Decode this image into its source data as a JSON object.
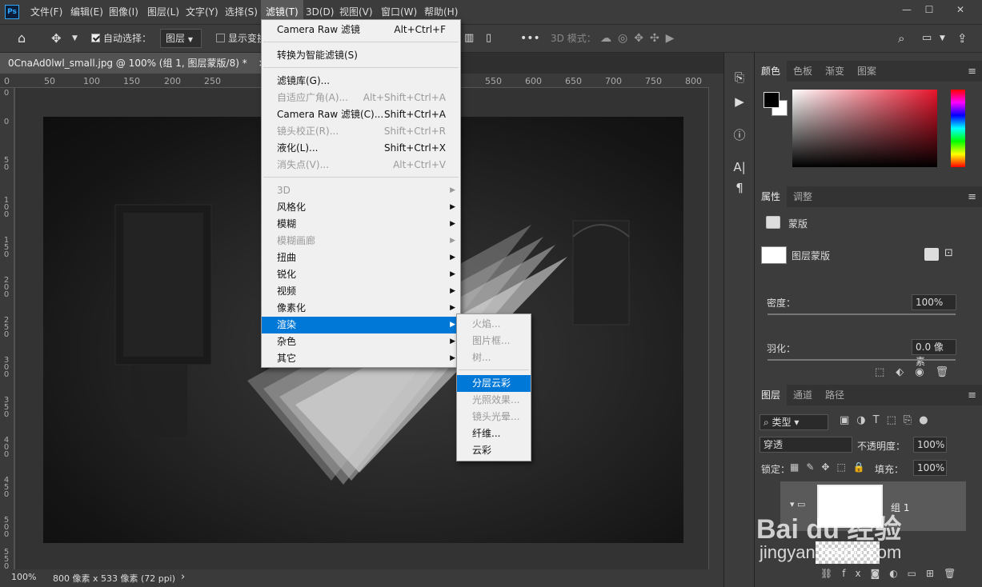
{
  "app": {
    "logo": "Ps"
  },
  "menubar": {
    "items": [
      "文件(F)",
      "编辑(E)",
      "图像(I)",
      "图层(L)",
      "文字(Y)",
      "选择(S)",
      "滤镜(T)",
      "3D(D)",
      "视图(V)",
      "窗口(W)",
      "帮助(H)"
    ]
  },
  "window_controls": {
    "minimize": "—",
    "restore": "☐",
    "close": "✕"
  },
  "options": {
    "auto_select_label": "自动选择：",
    "auto_select_value": "图层",
    "show_transform": "显示变换控件",
    "mode_3d_label": "3D 模式："
  },
  "document": {
    "tab_title": "0CnaAd0lwl_small.jpg @ 100% (组 1, 图层蒙版/8) *",
    "tab_close": "×"
  },
  "ruler": {
    "top": [
      "0",
      "50",
      "100",
      "150",
      "200",
      "250",
      "550",
      "600",
      "650",
      "700",
      "750",
      "800"
    ],
    "left": [
      "0",
      "0",
      "5 0",
      "1 0 0",
      "1 5 0",
      "2 0 0",
      "2 5 0",
      "3 0 0",
      "3 5 0",
      "4 0 0",
      "4 5 0",
      "5 0 0",
      "5 5 0"
    ]
  },
  "status": {
    "zoom": "100%",
    "info": "800 像素 x 533 像素 (72 ppi)",
    "arrow": "›"
  },
  "filter_menu": {
    "items": [
      {
        "label": "Camera Raw 滤镜",
        "shortcut": "Alt+Ctrl+F",
        "disabled": false
      },
      {
        "label": "转换为智能滤镜(S)",
        "shortcut": "",
        "disabled": false
      },
      {
        "label": "滤镜库(G)...",
        "shortcut": "",
        "disabled": false
      },
      {
        "label": "自适应广角(A)...",
        "shortcut": "Alt+Shift+Ctrl+A",
        "disabled": true
      },
      {
        "label": "Camera Raw 滤镜(C)...",
        "shortcut": "Shift+Ctrl+A",
        "disabled": false
      },
      {
        "label": "镜头校正(R)...",
        "shortcut": "Shift+Ctrl+R",
        "disabled": true
      },
      {
        "label": "液化(L)...",
        "shortcut": "Shift+Ctrl+X",
        "disabled": false
      },
      {
        "label": "消失点(V)...",
        "shortcut": "Alt+Ctrl+V",
        "disabled": true
      },
      {
        "label": "3D",
        "disabled": true
      },
      {
        "label": "风格化",
        "disabled": false
      },
      {
        "label": "模糊",
        "disabled": false
      },
      {
        "label": "模糊画廊",
        "disabled": true
      },
      {
        "label": "扭曲",
        "disabled": false
      },
      {
        "label": "锐化",
        "disabled": false
      },
      {
        "label": "视频",
        "disabled": false
      },
      {
        "label": "像素化",
        "disabled": false
      },
      {
        "label": "渲染",
        "disabled": false,
        "highlighted": true
      },
      {
        "label": "杂色",
        "disabled": false
      },
      {
        "label": "其它",
        "disabled": false
      }
    ]
  },
  "render_submenu": {
    "items": [
      {
        "label": "火焰...",
        "disabled": true
      },
      {
        "label": "图片框...",
        "disabled": true
      },
      {
        "label": "树...",
        "disabled": true
      },
      {
        "label": "分层云彩",
        "highlighted": true
      },
      {
        "label": "光照效果...",
        "disabled": true
      },
      {
        "label": "镜头光晕...",
        "disabled": true
      },
      {
        "label": "纤维...",
        "disabled": false
      },
      {
        "label": "云彩",
        "disabled": false
      }
    ]
  },
  "color_panel": {
    "tabs": [
      "颜色",
      "色板",
      "渐变",
      "图案"
    ],
    "foreground": "#000000",
    "background": "#ffffff",
    "hue": "#ff0000"
  },
  "properties_panel": {
    "tabs": [
      "属性",
      "调整"
    ],
    "type_label": "蒙版",
    "layer_mask_label": "图层蒙版",
    "density_label": "密度：",
    "density_value": "100%",
    "feather_label": "羽化：",
    "feather_value": "0.0 像素"
  },
  "layers_panel": {
    "tabs": [
      "图层",
      "通道",
      "路径"
    ],
    "filter_kind": "类型",
    "blend_mode": "穿透",
    "opacity_label": "不透明度：",
    "opacity_value": "100%",
    "lock_label": "锁定：",
    "fill_label": "填充：",
    "fill_value": "100%",
    "group_name": "组 1",
    "fx": "fx"
  },
  "watermark": {
    "text": "Bai du 经验",
    "url": "jingyan.baidu.com"
  }
}
